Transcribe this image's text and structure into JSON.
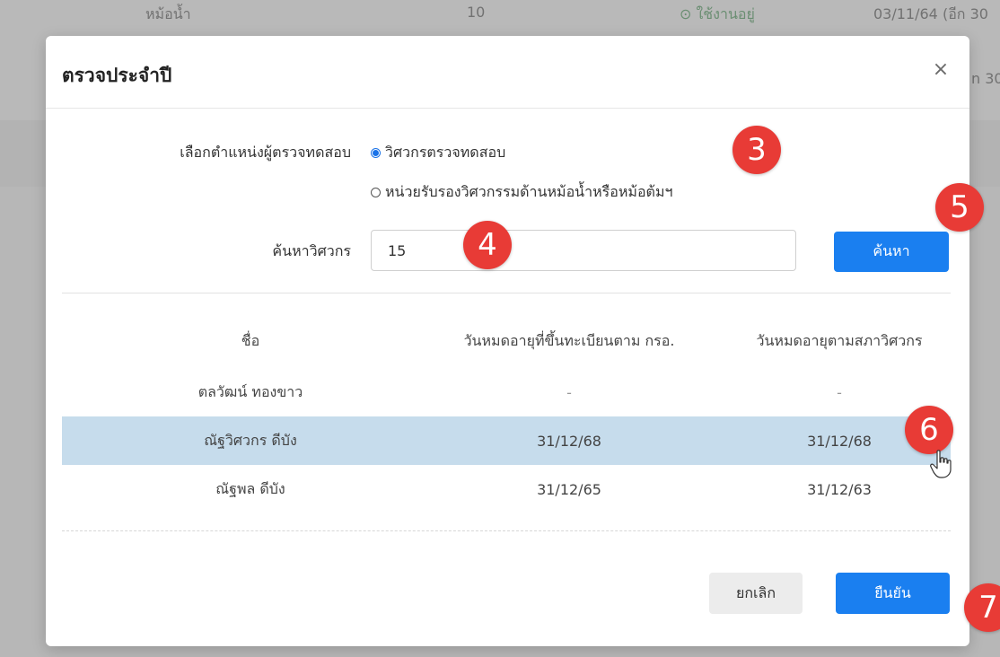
{
  "background": {
    "row1": {
      "name": "หม้อน้ำ",
      "count": "10",
      "status": "⊙ ใช้งานอยู่",
      "date": "03/11/64 (อีก 30"
    },
    "row2": {
      "date_fragment": "n 30"
    }
  },
  "modal": {
    "title": "ตรวจประจำปี",
    "close_label": "×",
    "inspector_type": {
      "label": "เลือกตำแหน่งผู้ตรวจทดสอบ",
      "options": [
        {
          "label": "วิศวกรตรวจทดสอบ",
          "selected": true
        },
        {
          "label": "หน่วยรับรองวิศวกรรมด้านหม้อน้ำหรือหม้อต้มฯ",
          "selected": false
        }
      ]
    },
    "search": {
      "label": "ค้นหาวิศวกร",
      "value": "15",
      "button_label": "ค้นหา"
    },
    "table": {
      "columns": [
        "ชื่อ",
        "วันหมดอายุที่ขึ้นทะเบียนตาม กรอ.",
        "วันหมดอายุตามสภาวิศวกร"
      ],
      "rows": [
        {
          "name": "ตลวัฒน์ ทองขาว",
          "dep_expiry": "-",
          "council_expiry": "-",
          "selected": false
        },
        {
          "name": "ณัฐวิศวกร ดีบัง",
          "dep_expiry": "31/12/68",
          "council_expiry": "31/12/68",
          "selected": true
        },
        {
          "name": "ณัฐพล ดีบัง",
          "dep_expiry": "31/12/65",
          "council_expiry": "31/12/63",
          "selected": false
        }
      ]
    },
    "footer": {
      "cancel_label": "ยกเลิก",
      "confirm_label": "ยืนยัน"
    }
  },
  "callouts": [
    "3",
    "4",
    "5",
    "6",
    "7"
  ],
  "colors": {
    "primary": "#1a7ff0",
    "selected_row": "#c6dcec",
    "callout": "#e83b36"
  }
}
